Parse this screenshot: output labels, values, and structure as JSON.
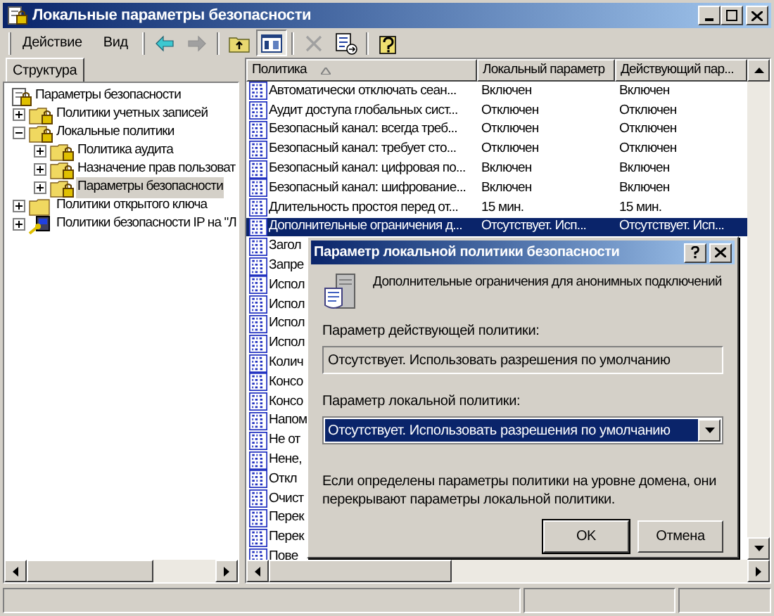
{
  "window": {
    "title": "Локальные параметры безопасности"
  },
  "menu": [
    "Действие",
    "Вид"
  ],
  "toolbar": [
    {
      "kind": "back",
      "disabled": false
    },
    {
      "kind": "forward",
      "disabled": true
    },
    {
      "kind": "up"
    },
    {
      "kind": "tree",
      "pressed": true
    },
    {
      "kind": "delete",
      "disabled": true
    },
    {
      "kind": "export"
    },
    {
      "kind": "help"
    }
  ],
  "tabs": [
    {
      "label": "Структура",
      "selected": true
    }
  ],
  "tree": [
    {
      "label": "Параметры безопасности",
      "kind": "root",
      "selected": false,
      "children": [
        {
          "label": "Политики учетных записей",
          "kind": "secured",
          "expanded": false,
          "selected": false
        },
        {
          "label": "Локальные политики",
          "kind": "secured",
          "expanded": true,
          "selected": false,
          "children": [
            {
              "label": "Политика аудита",
              "kind": "secured",
              "expanded": false,
              "selected": false
            },
            {
              "label": "Назначение прав пользоват",
              "kind": "secured",
              "expanded": false,
              "selected": false
            },
            {
              "label": "Параметры безопасности",
              "kind": "secured",
              "expanded": false,
              "selected": true
            }
          ]
        },
        {
          "label": "Политики открытого ключа",
          "kind": "folder",
          "expanded": false,
          "selected": false
        },
        {
          "label": "Политики безопасности IP на \"Л",
          "kind": "ip",
          "expanded": false,
          "selected": false
        }
      ]
    }
  ],
  "list": {
    "columns": [
      {
        "label": "Политика",
        "sorted": true
      },
      {
        "label": "Локальный параметр"
      },
      {
        "label": "Действующий пар..."
      }
    ],
    "rows": [
      {
        "name": "Автоматически отключать сеан...",
        "local": "Включен",
        "effective": "Включен",
        "selected": false
      },
      {
        "name": "Аудит доступа глобальных сист...",
        "local": "Отключен",
        "effective": "Отключен",
        "selected": false
      },
      {
        "name": "Безопасный канал: всегда треб...",
        "local": "Отключен",
        "effective": "Отключен",
        "selected": false
      },
      {
        "name": "Безопасный канал: требует сто...",
        "local": "Отключен",
        "effective": "Отключен",
        "selected": false
      },
      {
        "name": "Безопасный канал: цифровая по...",
        "local": "Включен",
        "effective": "Включен",
        "selected": false
      },
      {
        "name": "Безопасный канал: шифрование...",
        "local": "Включен",
        "effective": "Включен",
        "selected": false
      },
      {
        "name": "Длительность простоя перед от...",
        "local": "15 мин.",
        "effective": "15 мин.",
        "selected": false
      },
      {
        "name": "Дополнительные ограничения д...",
        "local": "Отсутствует. Исп...",
        "effective": "Отсутствует. Исп...",
        "selected": true
      },
      {
        "name": "Загол",
        "selected": false
      },
      {
        "name": "Запре",
        "selected": false
      },
      {
        "name": "Испол",
        "selected": false
      },
      {
        "name": "Испол",
        "selected": false
      },
      {
        "name": "Испол",
        "selected": false
      },
      {
        "name": "Испол",
        "selected": false
      },
      {
        "name": "Колич",
        "selected": false
      },
      {
        "name": "Консо",
        "selected": false
      },
      {
        "name": "Консо",
        "selected": false
      },
      {
        "name": "Напом",
        "selected": false
      },
      {
        "name": "Не от",
        "selected": false
      },
      {
        "name": "Нене,",
        "selected": false
      },
      {
        "name": "Откл",
        "selected": false
      },
      {
        "name": "Очист",
        "selected": false
      },
      {
        "name": "Перек",
        "selected": false
      },
      {
        "name": "Перек",
        "selected": false
      },
      {
        "name": "Пове",
        "selected": false
      }
    ]
  },
  "dialog": {
    "title": "Параметр локальной политики безопасности",
    "description": "Дополнительные ограничения для анонимных подключений",
    "effective_label": "Параметр действующей политики:",
    "effective_value": "Отсутствует. Использовать разрешения по умолчанию",
    "local_label": "Параметр локальной политики:",
    "local_value": "Отсутствует. Использовать разрешения по умолчанию",
    "note": "Если определены параметры политики на уровне домена, они перекрывают параметры локальной политики.",
    "buttons": [
      {
        "label": "OK",
        "default": true
      },
      {
        "label": "Отмена",
        "default": false
      }
    ]
  }
}
